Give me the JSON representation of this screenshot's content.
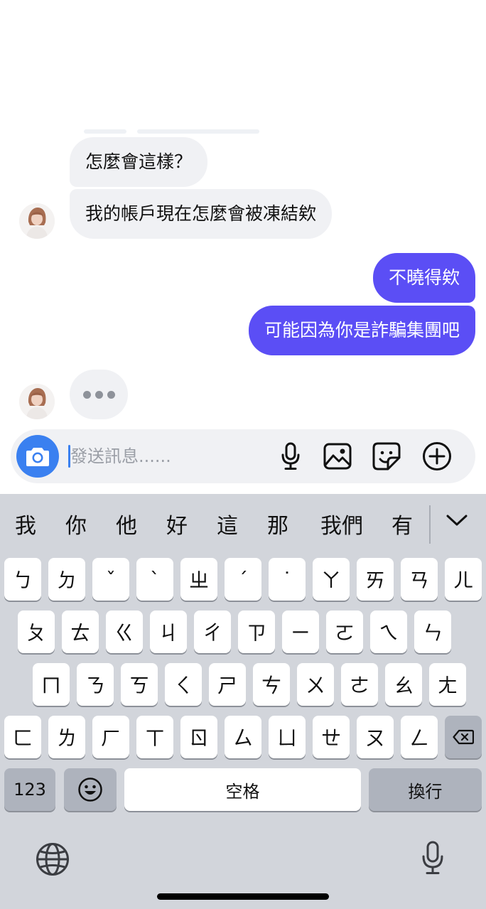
{
  "chat": {
    "incoming": [
      {
        "text": "怎麼會這樣？"
      },
      {
        "text": "我的帳戶現在怎麼會被凍結欸"
      }
    ],
    "outgoing": [
      {
        "text": "不曉得欸"
      },
      {
        "text": "可能因為你是詐騙集團吧"
      }
    ],
    "typing_indicator": true
  },
  "composer": {
    "placeholder": "發送訊息......",
    "icons": [
      "camera-icon",
      "microphone-icon",
      "image-icon",
      "sticker-icon",
      "add-icon"
    ]
  },
  "keyboard": {
    "suggestions": [
      "我",
      "你",
      "他",
      "好",
      "這",
      "那",
      "我們",
      "有"
    ],
    "rows": [
      [
        "ㄅ",
        "ㄉ",
        "ˇ",
        "ˋ",
        "ㄓ",
        "ˊ",
        "˙",
        "ㄚ",
        "ㄞ",
        "ㄢ",
        "ㄦ"
      ],
      [
        "ㄆ",
        "ㄊ",
        "ㄍ",
        "ㄐ",
        "ㄔ",
        "ㄗ",
        "ㄧ",
        "ㄛ",
        "ㄟ",
        "ㄣ"
      ],
      [
        "ㄇ",
        "ㄋ",
        "ㄎ",
        "ㄑ",
        "ㄕ",
        "ㄘ",
        "ㄨ",
        "ㄜ",
        "ㄠ",
        "ㄤ"
      ],
      [
        "ㄈ",
        "ㄌ",
        "ㄏ",
        "ㄒ",
        "ㄖ",
        "ㄙ",
        "ㄩ",
        "ㄝ",
        "ㄡ",
        "ㄥ"
      ]
    ],
    "numbers_label": "123",
    "space_label": "空格",
    "return_label": "換行",
    "accent_color": "#5b4ef5",
    "camera_color": "#3a80f0"
  }
}
